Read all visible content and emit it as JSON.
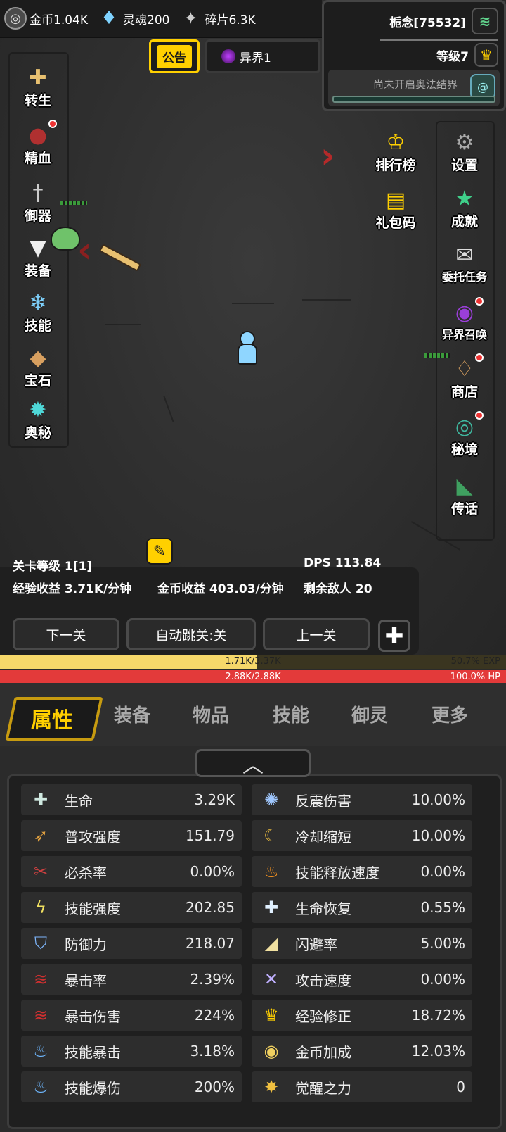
{
  "top_resources": {
    "gold": "金币1.04K",
    "soul": "灵魂200",
    "shard": "碎片6.3K"
  },
  "player": {
    "name": "栀念[75532]",
    "level": "等级7",
    "realm_status": "尚未开启奥法结界"
  },
  "notice_tab": "公告",
  "realm_tab": "异界1",
  "left_menu": [
    {
      "label": "转生",
      "icon": "cross-icon"
    },
    {
      "label": "精血",
      "icon": "meat-icon"
    },
    {
      "label": "御器",
      "icon": "sword-icon"
    },
    {
      "label": "装备",
      "icon": "armor-icon"
    },
    {
      "label": "技能",
      "icon": "ice-crystal-icon"
    },
    {
      "label": "宝石",
      "icon": "gem-bag-icon"
    },
    {
      "label": "奥秘",
      "icon": "arcane-icon"
    }
  ],
  "right_menu": [
    {
      "label": "设置",
      "icon": "gear-icon"
    },
    {
      "label": "成就",
      "icon": "star-icon"
    },
    {
      "label": "委托任务",
      "icon": "scroll-icon"
    },
    {
      "label": "异界召唤",
      "icon": "portal-icon"
    },
    {
      "label": "商店",
      "icon": "shop-icon"
    },
    {
      "label": "秘境",
      "icon": "gate-icon"
    },
    {
      "label": "传话",
      "icon": "horn-icon"
    }
  ],
  "mid_menu": [
    {
      "label": "排行榜",
      "icon": "trophy-icon"
    },
    {
      "label": "礼包码",
      "icon": "chest-icon"
    }
  ],
  "stage": {
    "level": "关卡等级 1[1]",
    "dps": "DPS 113.84",
    "exp_income": "经验收益 3.71K/分钟",
    "gold_income": "金币收益 403.03/分钟",
    "enemies_left": "剩余敌人 20",
    "next_btn": "下一关",
    "auto_btn": "自动跳关:关",
    "prev_btn": "上一关"
  },
  "exp_bar": {
    "text": "1.71K/3.37K",
    "percent_text": "50.7% EXP",
    "fraction": 0.507,
    "color": "#f6d86a"
  },
  "hp_bar": {
    "text": "2.88K/2.88K",
    "percent_text": "100.0% HP",
    "fraction": 1.0,
    "color": "#e33a3a"
  },
  "tabs": [
    "属性",
    "装备",
    "物品",
    "技能",
    "御灵",
    "更多"
  ],
  "stats_left": [
    {
      "label": "生命",
      "value": "3.29K",
      "icon": "health-cross-icon"
    },
    {
      "label": "普攻强度",
      "value": "151.79",
      "icon": "arrow-icon"
    },
    {
      "label": "必杀率",
      "value": "0.00%",
      "icon": "slash-icon"
    },
    {
      "label": "技能强度",
      "value": "202.85",
      "icon": "lightning-icon"
    },
    {
      "label": "防御力",
      "value": "218.07",
      "icon": "shield-icon"
    },
    {
      "label": "暴击率",
      "value": "2.39%",
      "icon": "claw-icon"
    },
    {
      "label": "暴击伤害",
      "value": "224%",
      "icon": "claw-icon"
    },
    {
      "label": "技能暴击",
      "value": "3.18%",
      "icon": "blue-flame-icon"
    },
    {
      "label": "技能爆伤",
      "value": "200%",
      "icon": "blue-flame-icon"
    }
  ],
  "stats_right": [
    {
      "label": "反震伤害",
      "value": "10.00%",
      "icon": "shatter-icon"
    },
    {
      "label": "冷却缩短",
      "value": "10.00%",
      "icon": "crescent-icon"
    },
    {
      "label": "技能释放速度",
      "value": "0.00%",
      "icon": "fire-icon"
    },
    {
      "label": "生命恢复",
      "value": "0.55%",
      "icon": "regen-icon"
    },
    {
      "label": "闪避率",
      "value": "5.00%",
      "icon": "boot-icon"
    },
    {
      "label": "攻击速度",
      "value": "0.00%",
      "icon": "crossed-swords-icon"
    },
    {
      "label": "经验修正",
      "value": "18.72%",
      "icon": "crown-icon"
    },
    {
      "label": "金币加成",
      "value": "12.03%",
      "icon": "coin-icon"
    },
    {
      "label": "觉醒之力",
      "value": "0",
      "icon": "sun-badge-icon"
    }
  ]
}
